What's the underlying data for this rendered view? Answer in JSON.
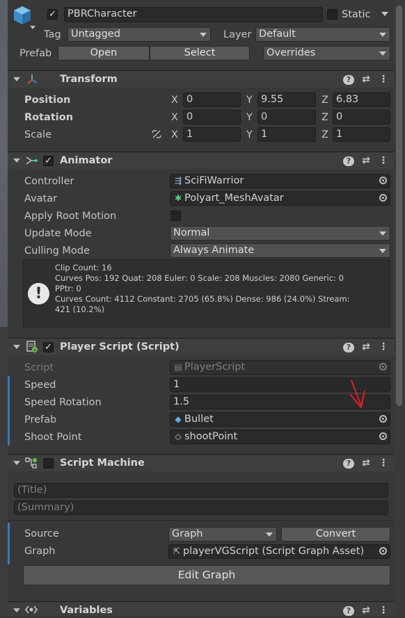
{
  "object": {
    "name": "PBRCharacter",
    "active": true,
    "static_label": "Static",
    "tag_label": "Tag",
    "tag_value": "Untagged",
    "layer_label": "Layer",
    "layer_value": "Default",
    "prefab_label": "Prefab",
    "open_label": "Open",
    "select_label": "Select",
    "overrides_label": "Overrides"
  },
  "transform": {
    "title": "Transform",
    "position_label": "Position",
    "rotation_label": "Rotation",
    "scale_label": "Scale",
    "axis_x": "X",
    "axis_y": "Y",
    "axis_z": "Z",
    "position": {
      "x": "0",
      "y": "9.55",
      "z": "6.83"
    },
    "rotation": {
      "x": "0",
      "y": "0",
      "z": "0"
    },
    "scale": {
      "x": "1",
      "y": "1",
      "z": "1"
    }
  },
  "animator": {
    "title": "Animator",
    "controller_label": "Controller",
    "controller_value": "SciFiWarrior",
    "avatar_label": "Avatar",
    "avatar_value": "Polyart_MeshAvatar",
    "apply_root_label": "Apply Root Motion",
    "update_mode_label": "Update Mode",
    "update_mode_value": "Normal",
    "culling_label": "Culling Mode",
    "culling_value": "Always Animate",
    "info_lines": [
      "Clip Count: 16",
      "Curves Pos: 192 Quat: 208 Euler: 0 Scale: 208 Muscles: 2080 Generic: 0",
      "PPtr: 0",
      "Curves Count: 4112 Constant: 2705 (65.8%) Dense: 986 (24.0%) Stream:",
      "421 (10.2%)"
    ]
  },
  "player_script": {
    "title": "Player Script (Script)",
    "script_label": "Script",
    "script_value": "PlayerScript",
    "speed_label": "Speed",
    "speed_value": "1",
    "speed_rotation_label": "Speed Rotation",
    "speed_rotation_value": "1.5",
    "prefab_label": "Prefab",
    "prefab_value": "Bullet",
    "shoot_point_label": "Shoot Point",
    "shoot_point_value": "shootPoint"
  },
  "script_machine": {
    "title": "Script Machine",
    "title_placeholder": "(Title)",
    "summary_placeholder": "(Summary)",
    "source_label": "Source",
    "source_value": "Graph",
    "convert_label": "Convert",
    "graph_label": "Graph",
    "graph_value": "playerVGScript (Script Graph Asset)",
    "edit_graph_label": "Edit Graph"
  },
  "variables": {
    "title": "Variables"
  },
  "icons": {
    "help": "?",
    "settings": "⇄",
    "more": "⋮"
  },
  "colors": {
    "accent": "#3a79bb",
    "annotation": "#e02020"
  }
}
